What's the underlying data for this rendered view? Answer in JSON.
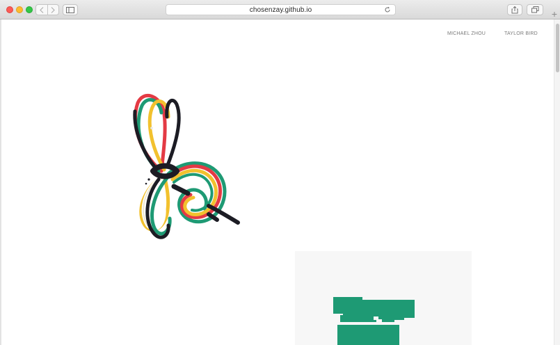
{
  "browser": {
    "url": "chosenzay.github.io",
    "icons": {
      "back": "chevron-left-icon",
      "forward": "chevron-right-icon",
      "sidebar": "sidebar-icon",
      "reload": "reload-icon",
      "share": "share-icon",
      "tabs": "tabs-icon",
      "new_tab": "plus-icon"
    },
    "new_tab_glyph": "+"
  },
  "nav": {
    "links": [
      {
        "label": "MICHAEL ZHOU"
      },
      {
        "label": "TAYLOR BIRD"
      }
    ]
  },
  "content": {
    "artwork_icon": "rubber-band-knot-image",
    "panel_accent": "#1e9a74"
  },
  "colors": {
    "chrome_bg": "#dddddd",
    "close": "#fc5b57",
    "minimize": "#fdbb2e",
    "zoom": "#33c748",
    "nav_text": "#7a7a7a",
    "green_shape": "#1e9a74"
  }
}
